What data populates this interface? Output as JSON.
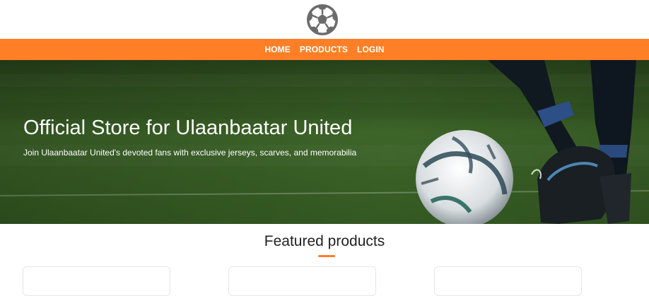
{
  "nav": {
    "items": [
      "HOME",
      "PRODUCTS",
      "LOGIN"
    ]
  },
  "hero": {
    "title": "Official Store for Ulaanbaatar United",
    "subtitle": "Join Ulaanbaatar United's devoted fans with exclusive jerseys, scarves, and memorabilia"
  },
  "featured": {
    "title": "Featured products",
    "card_count": 3
  },
  "colors": {
    "accent": "#ff7f27",
    "logo": "#666666",
    "pitch": "#3f6a2c"
  },
  "icons": {
    "logo": "soccer-ball-icon"
  }
}
